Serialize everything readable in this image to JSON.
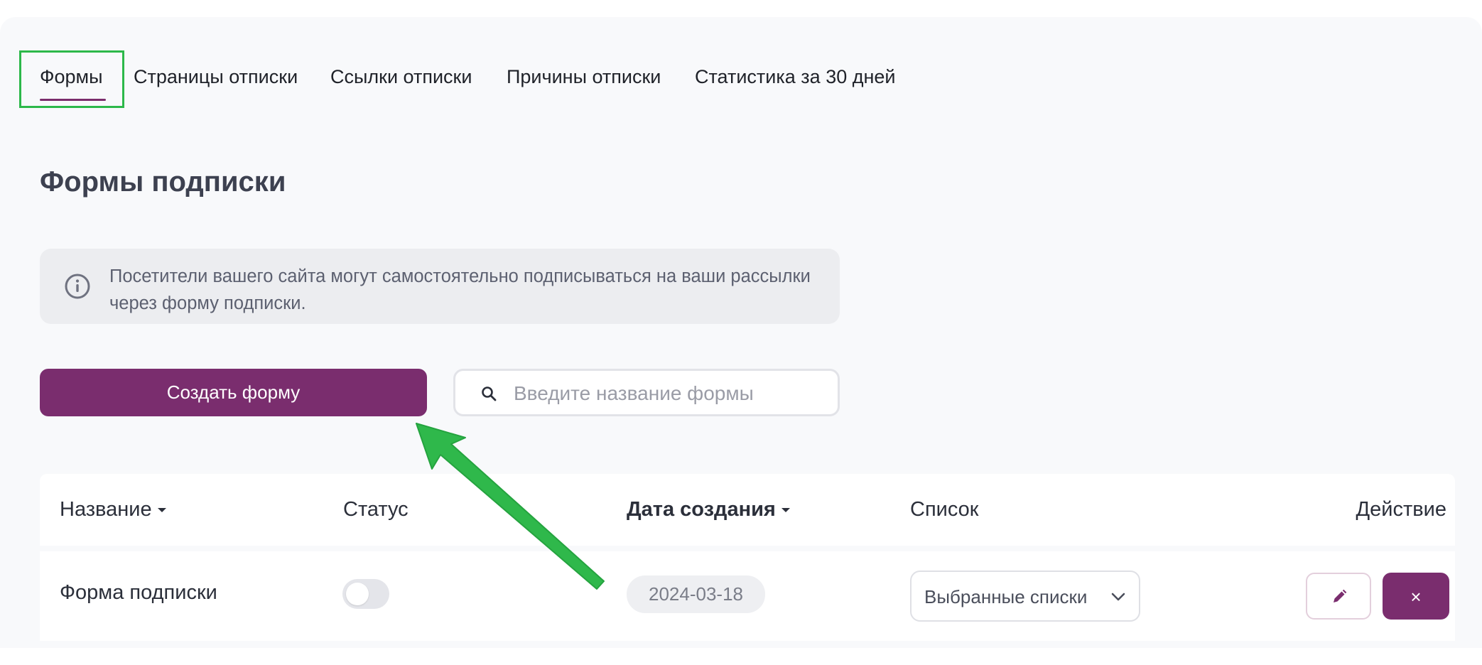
{
  "tabs": [
    {
      "label": "Формы",
      "active": true
    },
    {
      "label": "Страницы отписки"
    },
    {
      "label": "Ссылки отписки"
    },
    {
      "label": "Причины отписки"
    },
    {
      "label": "Статистика за 30 дней"
    }
  ],
  "page": {
    "title": "Формы подписки",
    "info_text": "Посетители вашего сайта могут самостоятельно подписываться на ваши рассылки через форму подписки."
  },
  "actions": {
    "create_label": "Создать форму",
    "search_placeholder": "Введите название формы",
    "search_value": ""
  },
  "table": {
    "columns": [
      {
        "label": "Название",
        "sortable": true
      },
      {
        "label": "Статус"
      },
      {
        "label": "Дата создания",
        "sortable": true,
        "sorted": true
      },
      {
        "label": "Список"
      },
      {
        "label": "Действие"
      }
    ],
    "rows": [
      {
        "name": "Форма подписки",
        "status_enabled": false,
        "created": "2024-03-18",
        "list": "Выбранные списки",
        "delete_glyph": "×"
      }
    ]
  },
  "icons": {
    "info": "info-circle-icon",
    "search": "search-icon",
    "caret": "caret-down-icon",
    "chevron": "chevron-down-icon",
    "edit": "pencil-icon",
    "delete": "close-icon",
    "annotation_arrow": "green-arrow-icon"
  },
  "colors": {
    "brand": "#7a2d6e",
    "annotation": "#2db84a",
    "panel_bg": "#f8f9fb",
    "info_bg": "#ecedf0"
  }
}
